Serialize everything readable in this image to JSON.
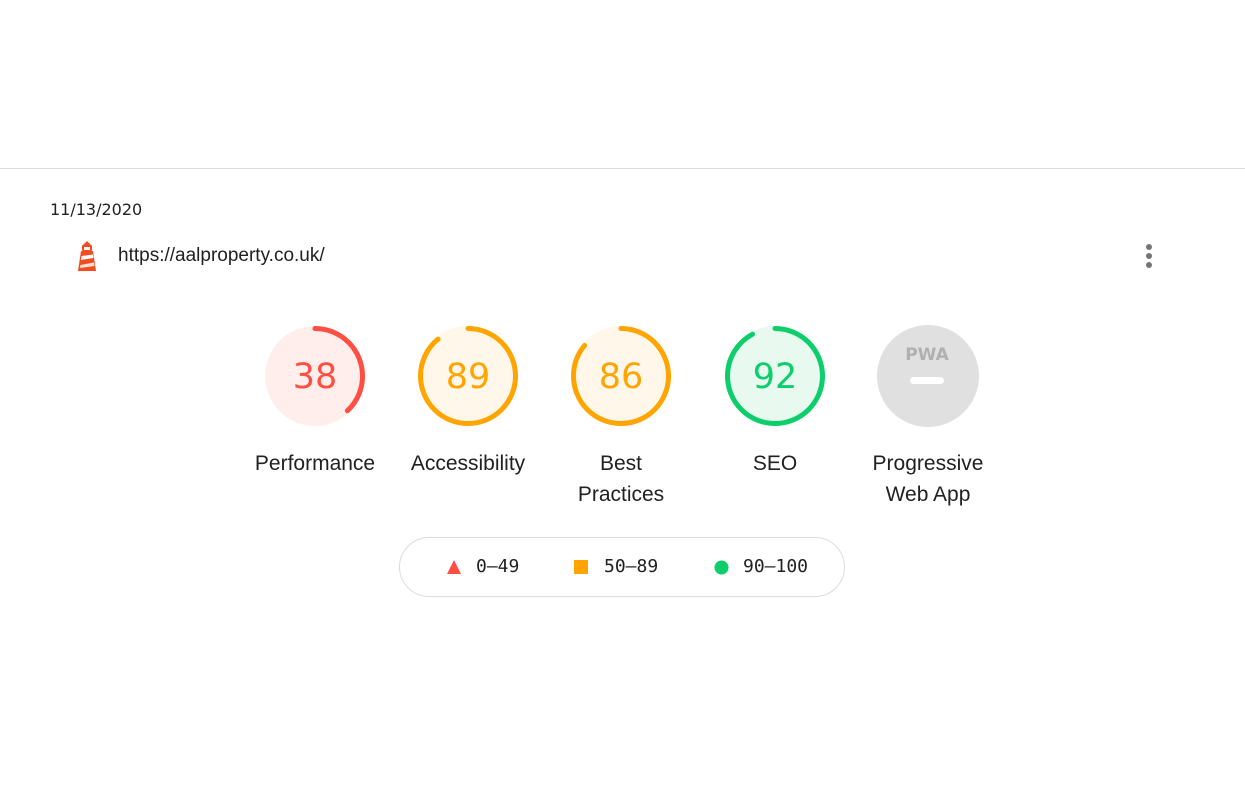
{
  "report": {
    "date": "11/13/2020",
    "url": "https://aalproperty.co.uk/"
  },
  "categories": [
    {
      "id": "performance",
      "score": "38",
      "label": "Performance",
      "value": 38,
      "color": "#ff4e42",
      "fill": "#ffeeec"
    },
    {
      "id": "accessibility",
      "score": "89",
      "label": "Accessibility",
      "value": 89,
      "color": "#ffa400",
      "fill": "#fff7e9"
    },
    {
      "id": "best-practices",
      "score": "86",
      "label": "Best Practices",
      "value": 86,
      "color": "#ffa400",
      "fill": "#fff7e9"
    },
    {
      "id": "seo",
      "score": "92",
      "label": "SEO",
      "value": 92,
      "color": "#0cce6b",
      "fill": "#e8faf0"
    },
    {
      "id": "pwa",
      "score": "",
      "label": "Progressive Web App",
      "value": null,
      "color": "#bdbdbd",
      "fill": "#e0e0e0",
      "badge": "PWA"
    }
  ],
  "legend": {
    "fail": "0–49",
    "average": "50–89",
    "pass": "90–100"
  },
  "icons": {
    "logo": "lighthouse-icon",
    "menu": "more-vert-icon"
  }
}
